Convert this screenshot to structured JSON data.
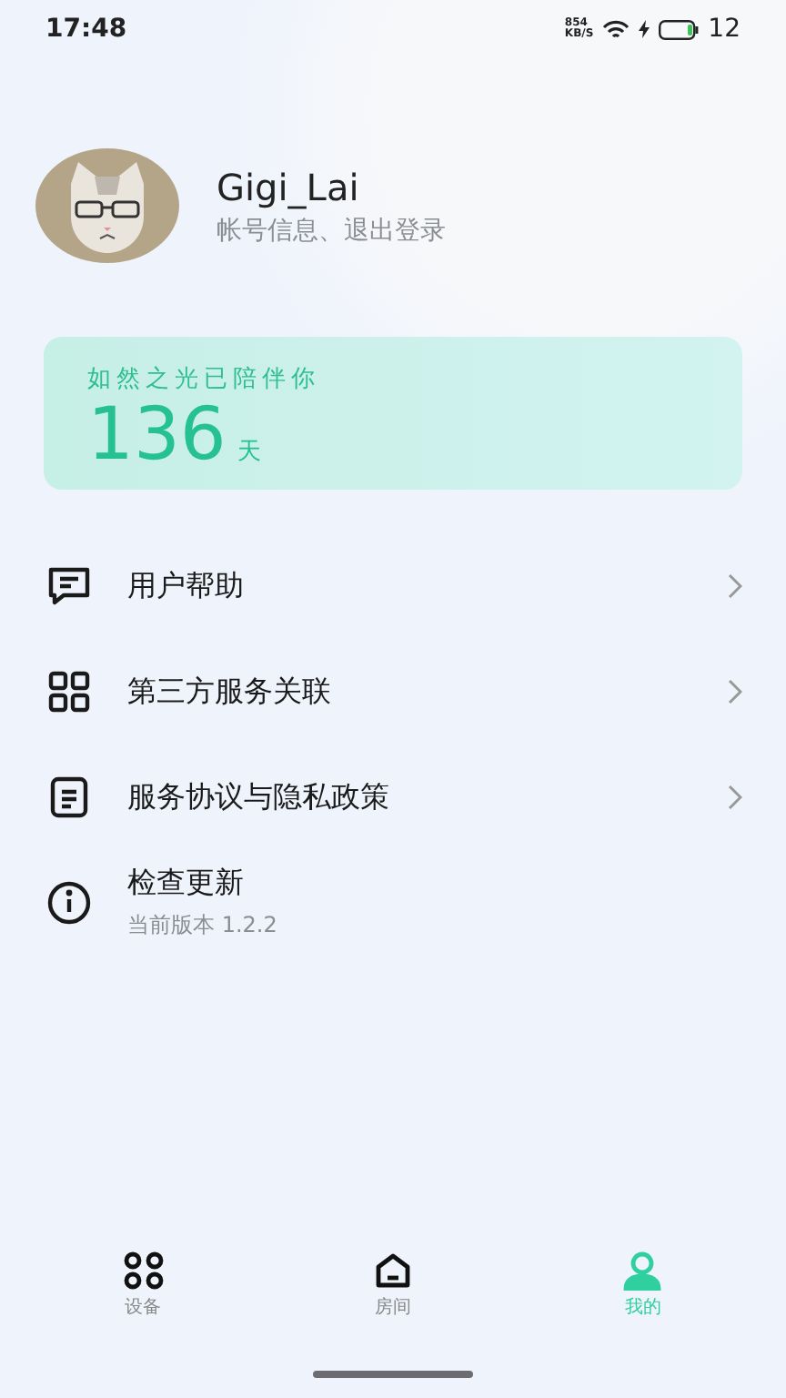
{
  "status_bar": {
    "time": "17:48",
    "speed_value": "854",
    "speed_unit": "KB/S",
    "battery": "12"
  },
  "profile": {
    "name": "Gigi_Lai",
    "subtitle": "帐号信息、退出登录"
  },
  "companion_card": {
    "caption": "如然之光已陪伴你",
    "days": "136",
    "unit": "天"
  },
  "menu": [
    {
      "kind": "chat",
      "label": "用户帮助",
      "arrow": true
    },
    {
      "kind": "grid",
      "label": "第三方服务关联",
      "arrow": true
    },
    {
      "kind": "doc",
      "label": "服务协议与隐私政策",
      "arrow": true
    },
    {
      "kind": "info",
      "label": "检查更新",
      "subtitle": "当前版本 1.2.2",
      "arrow": false
    }
  ],
  "tab_bar": [
    {
      "kind": "devices",
      "label": "设备",
      "selected": false
    },
    {
      "kind": "room",
      "label": "房间",
      "selected": false
    },
    {
      "kind": "me",
      "label": "我的",
      "selected": true
    }
  ]
}
